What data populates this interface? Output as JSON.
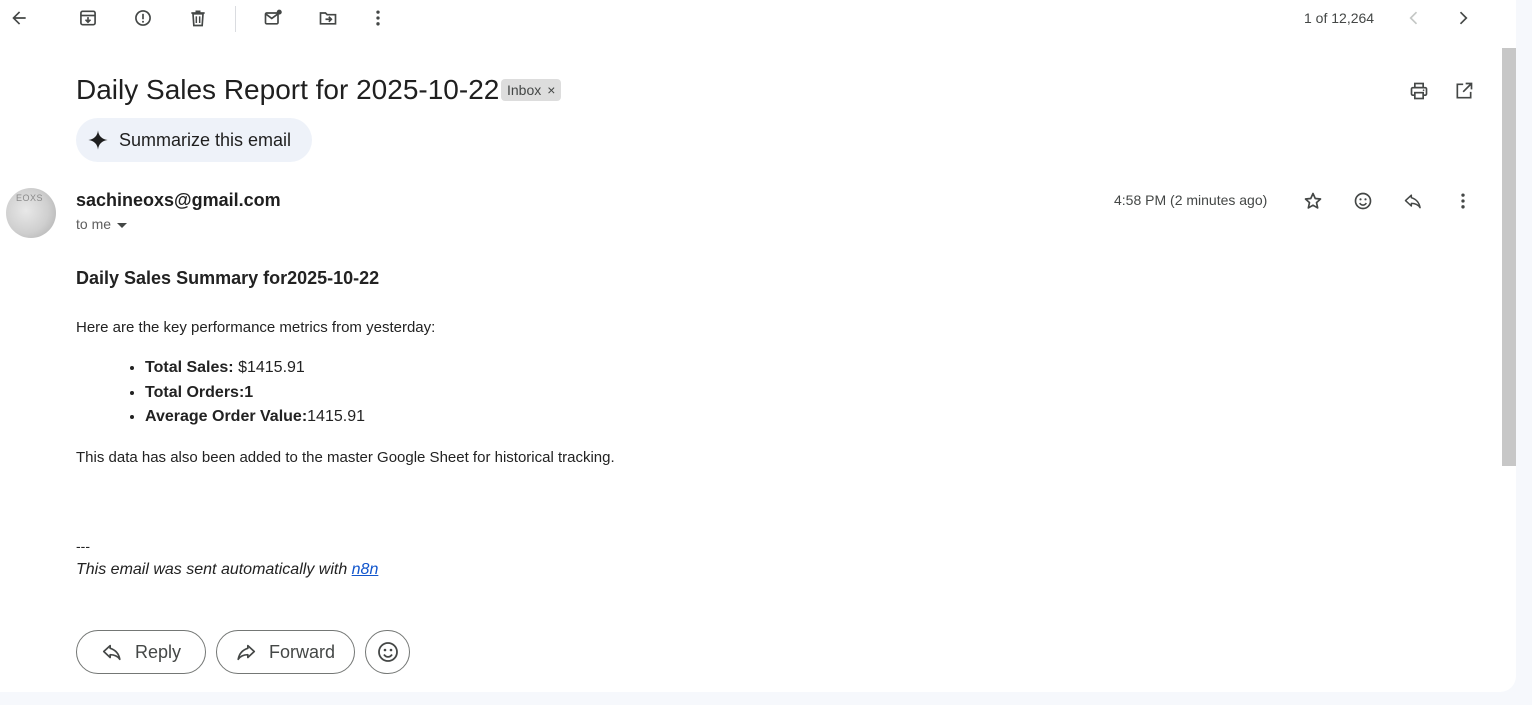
{
  "toolbar": {
    "icons": [
      "back-arrow-icon",
      "archive-icon",
      "report-spam-icon",
      "delete-icon",
      "mark-unread-icon",
      "move-to-icon",
      "more-vert-icon"
    ],
    "pager": "1 of 12,264"
  },
  "email": {
    "subject": "Daily Sales Report for 2025-10-22",
    "label": "Inbox",
    "label_remove": "×",
    "summarize_label": "Summarize this email",
    "avatar_text": "EOXS",
    "sender": "sachineoxs@gmail.com",
    "recipient": "to me",
    "timestamp": "4:58 PM (2 minutes ago)",
    "body": {
      "heading": "Daily Sales Summary for2025-10-22",
      "intro": "Here are the key performance metrics from yesterday:",
      "metrics": [
        {
          "label": "Total Sales:",
          "value": " $1415.91"
        },
        {
          "label": "Total Orders:1",
          "value": ""
        },
        {
          "label": "Average Order Value:",
          "value": "1415.91"
        }
      ],
      "note": "This data has also been added to the master Google Sheet for historical tracking.",
      "separator": "---",
      "footer_text": "This email was sent automatically with ",
      "footer_link": "n8n"
    }
  },
  "actions": {
    "reply_label": "Reply",
    "forward_label": "Forward"
  },
  "colors": {
    "background": "#f6f8fc",
    "chip": "#dddddd",
    "summarize_bg": "#eef2f9",
    "link": "#1155cc"
  }
}
